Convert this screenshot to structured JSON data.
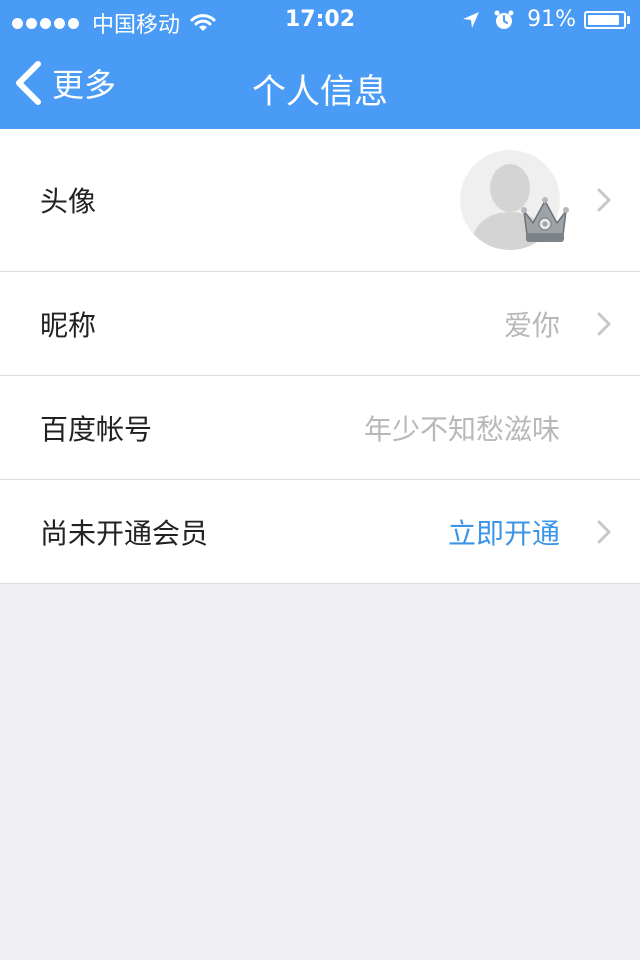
{
  "status_bar": {
    "carrier": "中国移动",
    "time": "17:02",
    "battery_text": "91%",
    "battery_level": 0.91,
    "icons": [
      "signal-dots-icon",
      "wifi-icon",
      "location-arrow-icon",
      "alarm-clock-icon",
      "battery-icon"
    ]
  },
  "nav": {
    "back_label": "更多",
    "title": "个人信息"
  },
  "rows": [
    {
      "label": "头像",
      "value": ""
    },
    {
      "label": "昵称",
      "value": "爱你"
    },
    {
      "label": "百度帐号",
      "value": "年少不知愁滋味"
    },
    {
      "label": "尚未开通会员",
      "value": "立即开通"
    }
  ],
  "colors": {
    "header_blue": "#4a9bf6",
    "link_blue": "#3d95e8",
    "page_bg": "#efeff4",
    "value_gray": "#b8b8b8"
  }
}
